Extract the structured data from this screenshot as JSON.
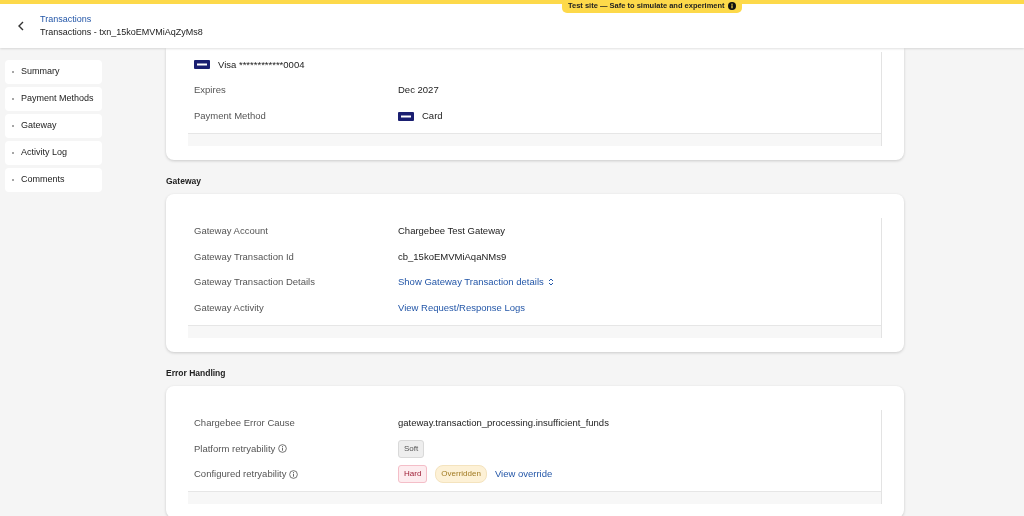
{
  "banner": {
    "text": "Test site — Safe to simulate and experiment"
  },
  "header": {
    "breadcrumb": "Transactions",
    "title": "Transactions - txn_15koEMVMiAqZyMs8"
  },
  "sidebar": {
    "items": [
      {
        "label": "Summary"
      },
      {
        "label": "Payment Methods"
      },
      {
        "label": "Gateway"
      },
      {
        "label": "Activity Log"
      },
      {
        "label": "Comments"
      }
    ]
  },
  "sections": [
    {
      "rows": [
        {
          "kind": "card",
          "label": "Visa ************0004"
        },
        {
          "kind": "field",
          "label": "Expires",
          "value": "Dec 2027"
        },
        {
          "kind": "field",
          "label": "Payment Method",
          "value": "Card",
          "card_logo": true
        }
      ]
    },
    {
      "heading": "Gateway",
      "rows": [
        {
          "kind": "field",
          "label": "Gateway Account",
          "value": "Chargebee Test Gateway"
        },
        {
          "kind": "field",
          "label": "Gateway Transaction Id",
          "value": "cb_15koEMVMiAqaNMs9"
        },
        {
          "kind": "field",
          "label": "Gateway Transaction Details",
          "link": "Show Gateway Transaction details",
          "expandable": true
        },
        {
          "kind": "field",
          "label": "Gateway Activity",
          "link": "View Request/Response Logs"
        }
      ]
    },
    {
      "heading": "Error Handling",
      "rows": [
        {
          "kind": "field",
          "label": "Chargebee Error Cause",
          "value": "gateway.transaction_processing.insufficient_funds"
        },
        {
          "kind": "field",
          "label": "Platform retryability",
          "info": true,
          "badges": [
            {
              "text": "Soft",
              "color": "#eeeeee"
            }
          ]
        },
        {
          "kind": "field",
          "label": "Configured retryability",
          "info": true,
          "badges": [
            {
              "text": "Hard",
              "color": "#fdecef"
            },
            {
              "text": "Overridden",
              "color": "#fdf1d6"
            }
          ],
          "link": "View override"
        }
      ]
    }
  ]
}
